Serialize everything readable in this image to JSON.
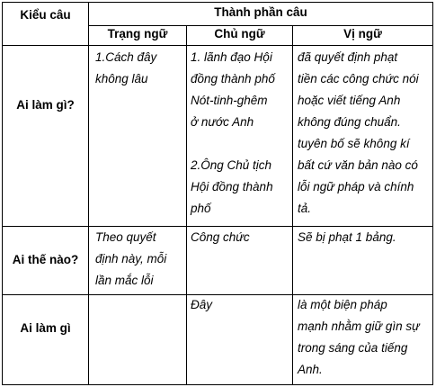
{
  "table": {
    "header": {
      "type_col": "Kiểu câu",
      "group": "Thành phần câu",
      "col_adverbial": "Trạng ngữ",
      "col_subject": "Chủ ngữ",
      "col_predicate": "Vị ngữ"
    },
    "rows": [
      {
        "type": "Ai làm gì?",
        "adverbial": [
          "1.Cách đây",
          "không lâu"
        ],
        "subject": [
          "1. lãnh đạo Hội",
          "đồng thành phố",
          "Nót-tinh-ghêm",
          "ở nước Anh",
          "",
          "2.Ông Chủ tịch",
          "Hội đồng thành",
          "phố"
        ],
        "predicate": [
          "đã quyết định phạt",
          "tiền các công chức nói",
          "hoặc viết tiếng Anh",
          "không đúng chuẩn.",
          "tuyên bố sẽ không kí",
          "bất cứ văn bản nào có",
          "lỗi ngữ pháp và chính",
          "tả."
        ]
      },
      {
        "type": "Ai thế nào?",
        "adverbial": [
          "Theo quyết",
          "định này, mỗi",
          "lần mắc lỗi"
        ],
        "subject": [
          "Công chức"
        ],
        "predicate": [
          "Sẽ bị phạt 1 bảng."
        ]
      },
      {
        "type": "Ai làm gì",
        "adverbial": [],
        "subject": [
          "Đây"
        ],
        "predicate": [
          "là một biện pháp",
          "mạnh nhằm giữ gìn sự",
          "trong sáng của tiếng",
          "Anh."
        ]
      }
    ]
  }
}
